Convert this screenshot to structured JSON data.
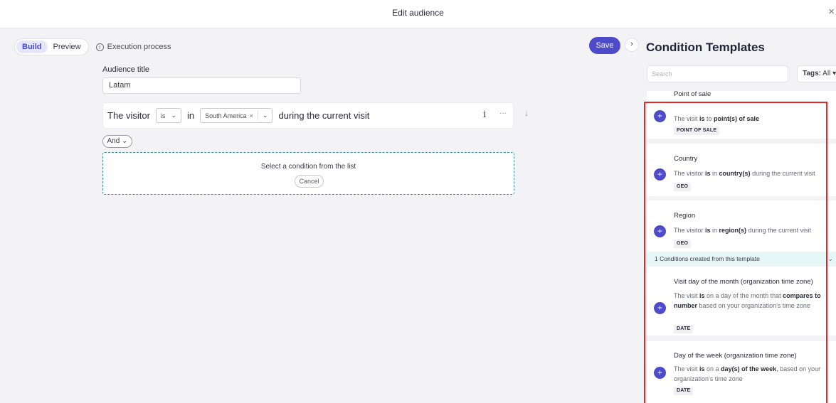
{
  "topbar": {
    "title": "Edit audience",
    "close_glyph": "×"
  },
  "toolbar": {
    "tabs": [
      "Build",
      "Preview"
    ],
    "active_tab": "Build",
    "execution_label": "Execution process",
    "info_glyph": "i",
    "save_label": "Save"
  },
  "audience": {
    "title_label": "Audience title",
    "title_value": "Latam"
  },
  "condition": {
    "subject": "The visitor",
    "operator": "is",
    "preposition": "in",
    "chip": "South America",
    "chip_remove": "×",
    "suffix": "during the current visit",
    "info_glyph": "i",
    "more_glyph": "···",
    "move_glyph": "↓"
  },
  "and_button": "And",
  "dropzone": {
    "message": "Select a condition from the list",
    "cancel_label": "Cancel"
  },
  "panel": {
    "collapse_glyph": "›",
    "title": "Condition Templates",
    "search_placeholder": "Search",
    "tags_label": "Tags:",
    "tags_value": "All",
    "templates": [
      {
        "name": "Point of sale",
        "desc_parts": [
          "The visit ",
          "is",
          " to ",
          "point(s) of sale",
          ""
        ],
        "tag": "POINT OF SALE"
      },
      {
        "name": "Country",
        "desc_parts": [
          "The visitor ",
          "is",
          " in ",
          "country(s)",
          " during the current visit"
        ],
        "tag": "GEO"
      },
      {
        "name": "Region",
        "desc_parts": [
          "The visitor ",
          "is",
          " in ",
          "region(s)",
          " during the current visit"
        ],
        "tag": "GEO",
        "created_note": "1 Conditions created from this template"
      },
      {
        "name": "Visit day of the month (organization time zone)",
        "desc_parts": [
          "The visit ",
          "is",
          " on a day of the month that ",
          "compares to number",
          " based on your organization's time zone"
        ],
        "tag": "DATE"
      },
      {
        "name": "Day of the week (organization time zone)",
        "desc_parts": [
          "The visit ",
          "is",
          " on a ",
          "day(s) of the week",
          ", based on your organization's time zone"
        ],
        "tag": "DATE"
      }
    ]
  },
  "colors": {
    "accent": "#4e4bcb",
    "highlight": "#dd2a2a",
    "dashed": "#2f8f9a",
    "created_bar": "#e6f7f7"
  }
}
